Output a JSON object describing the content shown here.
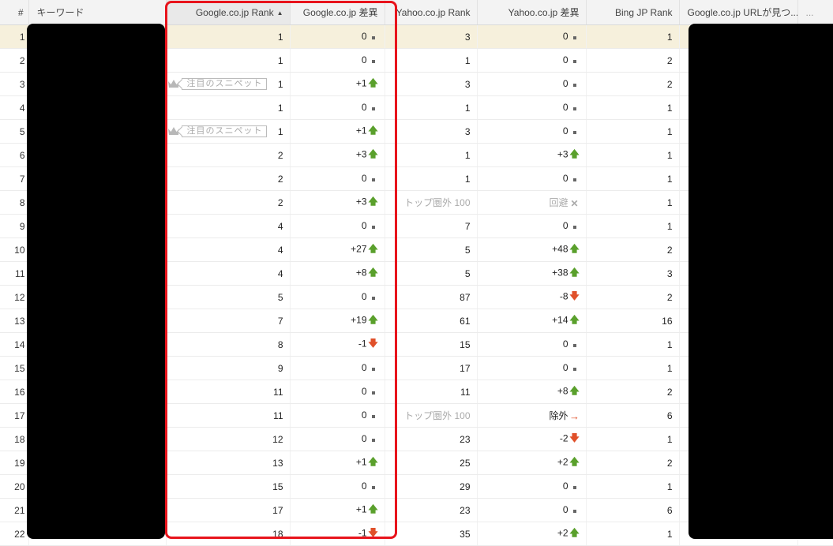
{
  "headers": {
    "idx": "#",
    "keyword": "キーワード",
    "google_rank": "Google.co.jp Rank",
    "google_rank_sort": "▲",
    "google_diff": "Google.co.jp 差異",
    "yahoo_rank": "Yahoo.co.jp Rank",
    "yahoo_diff": "Yahoo.co.jp 差異",
    "bing_rank": "Bing JP Rank",
    "google_url": "Google.co.jp URLが見つ...",
    "more": "..."
  },
  "snippet_label": "注目のスニペット",
  "colors": {
    "up": "#5aa02c",
    "down": "#e0502a",
    "highlight": "#e8141c",
    "selected_row": "#f6f0dc"
  },
  "rows": [
    {
      "idx": "1",
      "snippet": false,
      "g_rank": "1",
      "g_diff": "0",
      "g_mark": "dot",
      "y_rank": "3",
      "y_rank_gray": false,
      "y_diff": "0",
      "y_mark": "dot",
      "y_diff_gray": false,
      "bing": "1"
    },
    {
      "idx": "2",
      "snippet": false,
      "g_rank": "1",
      "g_diff": "0",
      "g_mark": "dot",
      "y_rank": "1",
      "y_rank_gray": false,
      "y_diff": "0",
      "y_mark": "dot",
      "y_diff_gray": false,
      "bing": "2"
    },
    {
      "idx": "3",
      "snippet": true,
      "g_rank": "1",
      "g_diff": "+1",
      "g_mark": "up",
      "y_rank": "3",
      "y_rank_gray": false,
      "y_diff": "0",
      "y_mark": "dot",
      "y_diff_gray": false,
      "bing": "2"
    },
    {
      "idx": "4",
      "snippet": false,
      "g_rank": "1",
      "g_diff": "0",
      "g_mark": "dot",
      "y_rank": "1",
      "y_rank_gray": false,
      "y_diff": "0",
      "y_mark": "dot",
      "y_diff_gray": false,
      "bing": "1"
    },
    {
      "idx": "5",
      "snippet": true,
      "g_rank": "1",
      "g_diff": "+1",
      "g_mark": "up",
      "y_rank": "3",
      "y_rank_gray": false,
      "y_diff": "0",
      "y_mark": "dot",
      "y_diff_gray": false,
      "bing": "1"
    },
    {
      "idx": "6",
      "snippet": false,
      "g_rank": "2",
      "g_diff": "+3",
      "g_mark": "up",
      "y_rank": "1",
      "y_rank_gray": false,
      "y_diff": "+3",
      "y_mark": "up",
      "y_diff_gray": false,
      "bing": "1"
    },
    {
      "idx": "7",
      "snippet": false,
      "g_rank": "2",
      "g_diff": "0",
      "g_mark": "dot",
      "y_rank": "1",
      "y_rank_gray": false,
      "y_diff": "0",
      "y_mark": "dot",
      "y_diff_gray": false,
      "bing": "1"
    },
    {
      "idx": "8",
      "snippet": false,
      "g_rank": "2",
      "g_diff": "+3",
      "g_mark": "up",
      "y_rank": "トップ圏外 100",
      "y_rank_gray": true,
      "y_diff": "回避",
      "y_mark": "x",
      "y_diff_gray": true,
      "bing": "1"
    },
    {
      "idx": "9",
      "snippet": false,
      "g_rank": "4",
      "g_diff": "0",
      "g_mark": "dot",
      "y_rank": "7",
      "y_rank_gray": false,
      "y_diff": "0",
      "y_mark": "dot",
      "y_diff_gray": false,
      "bing": "1"
    },
    {
      "idx": "10",
      "snippet": false,
      "g_rank": "4",
      "g_diff": "+27",
      "g_mark": "up",
      "y_rank": "5",
      "y_rank_gray": false,
      "y_diff": "+48",
      "y_mark": "up",
      "y_diff_gray": false,
      "bing": "2"
    },
    {
      "idx": "11",
      "snippet": false,
      "g_rank": "4",
      "g_diff": "+8",
      "g_mark": "up",
      "y_rank": "5",
      "y_rank_gray": false,
      "y_diff": "+38",
      "y_mark": "up",
      "y_diff_gray": false,
      "bing": "3"
    },
    {
      "idx": "12",
      "snippet": false,
      "g_rank": "5",
      "g_diff": "0",
      "g_mark": "dot",
      "y_rank": "87",
      "y_rank_gray": false,
      "y_diff": "-8",
      "y_mark": "down",
      "y_diff_gray": false,
      "bing": "2"
    },
    {
      "idx": "13",
      "snippet": false,
      "g_rank": "7",
      "g_diff": "+19",
      "g_mark": "up",
      "y_rank": "61",
      "y_rank_gray": false,
      "y_diff": "+14",
      "y_mark": "up",
      "y_diff_gray": false,
      "bing": "16"
    },
    {
      "idx": "14",
      "snippet": false,
      "g_rank": "8",
      "g_diff": "-1",
      "g_mark": "down",
      "y_rank": "15",
      "y_rank_gray": false,
      "y_diff": "0",
      "y_mark": "dot",
      "y_diff_gray": false,
      "bing": "1"
    },
    {
      "idx": "15",
      "snippet": false,
      "g_rank": "9",
      "g_diff": "0",
      "g_mark": "dot",
      "y_rank": "17",
      "y_rank_gray": false,
      "y_diff": "0",
      "y_mark": "dot",
      "y_diff_gray": false,
      "bing": "1"
    },
    {
      "idx": "16",
      "snippet": false,
      "g_rank": "11",
      "g_diff": "0",
      "g_mark": "dot",
      "y_rank": "11",
      "y_rank_gray": false,
      "y_diff": "+8",
      "y_mark": "up",
      "y_diff_gray": false,
      "bing": "2"
    },
    {
      "idx": "17",
      "snippet": false,
      "g_rank": "11",
      "g_diff": "0",
      "g_mark": "dot",
      "y_rank": "トップ圏外 100",
      "y_rank_gray": true,
      "y_diff": "除外",
      "y_mark": "right",
      "y_diff_gray": false,
      "bing": "6"
    },
    {
      "idx": "18",
      "snippet": false,
      "g_rank": "12",
      "g_diff": "0",
      "g_mark": "dot",
      "y_rank": "23",
      "y_rank_gray": false,
      "y_diff": "-2",
      "y_mark": "down",
      "y_diff_gray": false,
      "bing": "1"
    },
    {
      "idx": "19",
      "snippet": false,
      "g_rank": "13",
      "g_diff": "+1",
      "g_mark": "up",
      "y_rank": "25",
      "y_rank_gray": false,
      "y_diff": "+2",
      "y_mark": "up",
      "y_diff_gray": false,
      "bing": "2"
    },
    {
      "idx": "20",
      "snippet": false,
      "g_rank": "15",
      "g_diff": "0",
      "g_mark": "dot",
      "y_rank": "29",
      "y_rank_gray": false,
      "y_diff": "0",
      "y_mark": "dot",
      "y_diff_gray": false,
      "bing": "1"
    },
    {
      "idx": "21",
      "snippet": false,
      "g_rank": "17",
      "g_diff": "+1",
      "g_mark": "up",
      "y_rank": "23",
      "y_rank_gray": false,
      "y_diff": "0",
      "y_mark": "dot",
      "y_diff_gray": false,
      "bing": "6"
    },
    {
      "idx": "22",
      "snippet": false,
      "g_rank": "18",
      "g_diff": "-1",
      "g_mark": "down",
      "y_rank": "35",
      "y_rank_gray": false,
      "y_diff": "+2",
      "y_mark": "up",
      "y_diff_gray": false,
      "bing": "1"
    }
  ]
}
